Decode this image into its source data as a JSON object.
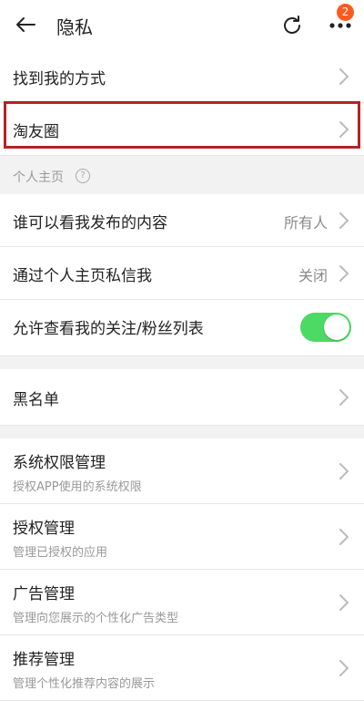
{
  "header": {
    "title": "隐私",
    "back_icon": "arrow-left-icon",
    "refresh_icon": "refresh-icon",
    "more_icon": "more-dots-icon",
    "badge_count": "2"
  },
  "items": {
    "find_me": {
      "label": "找到我的方式"
    },
    "taoyouquan": {
      "label": "淘友圈"
    }
  },
  "personal_section": {
    "title": "个人主页",
    "help_icon": "?",
    "who_can_see": {
      "label": "谁可以看我发布的内容",
      "value": "所有人"
    },
    "pm_via_profile": {
      "label": "通过个人主页私信我",
      "value": "关闭"
    },
    "allow_follow_list": {
      "label": "允许查看我的关注/粉丝列表",
      "enabled": true
    }
  },
  "blacklist": {
    "label": "黑名单"
  },
  "management": [
    {
      "label": "系统权限管理",
      "sub": "授权APP使用的系统权限"
    },
    {
      "label": "授权管理",
      "sub": "管理已授权的应用"
    },
    {
      "label": "广告管理",
      "sub": "管理向您展示的个性化广告类型"
    },
    {
      "label": "推荐管理",
      "sub": "管理个性化推荐内容的展示"
    }
  ],
  "colors": {
    "toggle_on": "#4cd964",
    "highlight_border": "#b42222",
    "badge": "#ff5a1f"
  }
}
